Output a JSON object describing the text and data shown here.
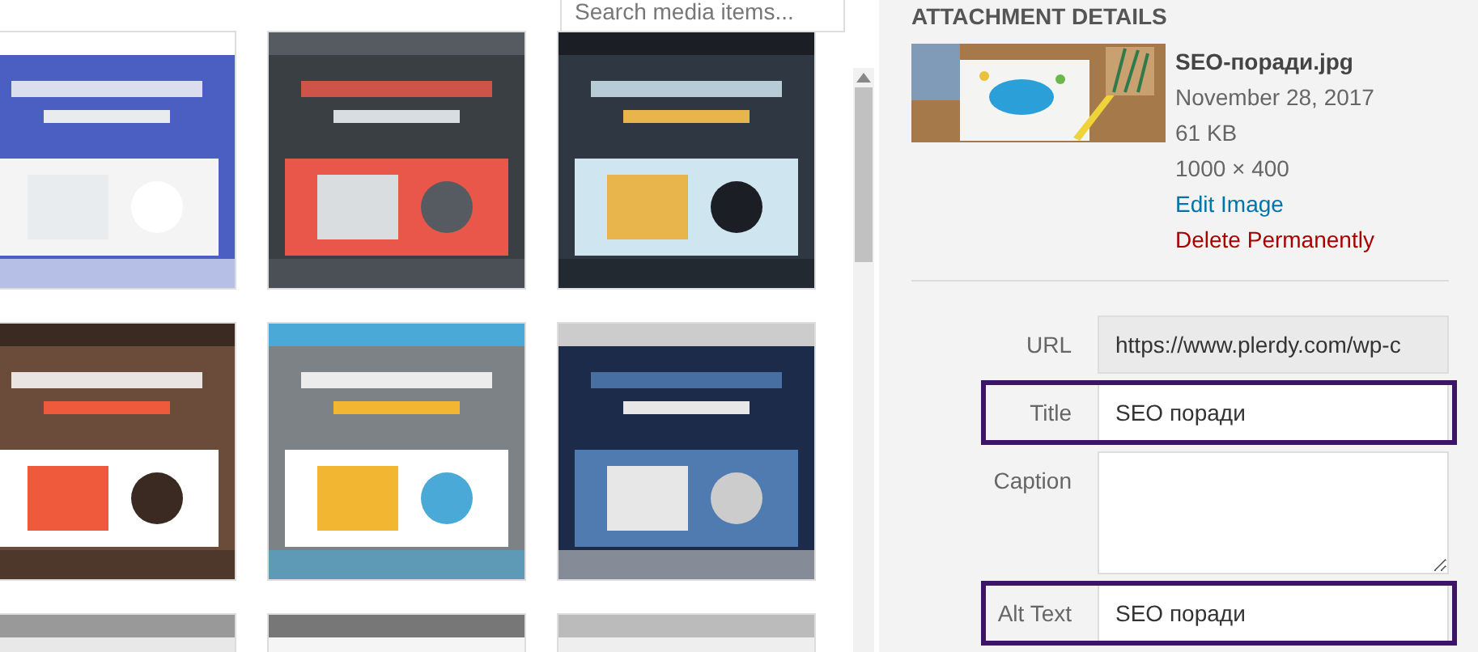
{
  "search": {
    "placeholder": "Search media items..."
  },
  "details": {
    "heading": "ATTACHMENT DETAILS",
    "filename": "SEO-поради.jpg",
    "date": "November 28, 2017",
    "size": "61 KB",
    "dimensions": "1000 × 400",
    "edit_link": "Edit Image",
    "delete_link": "Delete Permanently",
    "fields": [
      {
        "label": "URL",
        "kind": "input",
        "value": "https://www.plerdy.com/wp-c",
        "disabled": true,
        "highlighted": false
      },
      {
        "label": "Title",
        "kind": "input",
        "value": "SEO поради",
        "disabled": false,
        "highlighted": true
      },
      {
        "label": "Caption",
        "kind": "textarea",
        "disabled": false,
        "highlighted": false
      },
      {
        "label": "Alt Text",
        "kind": "input",
        "value": "SEO поради",
        "disabled": false,
        "highlighted": true
      }
    ]
  }
}
